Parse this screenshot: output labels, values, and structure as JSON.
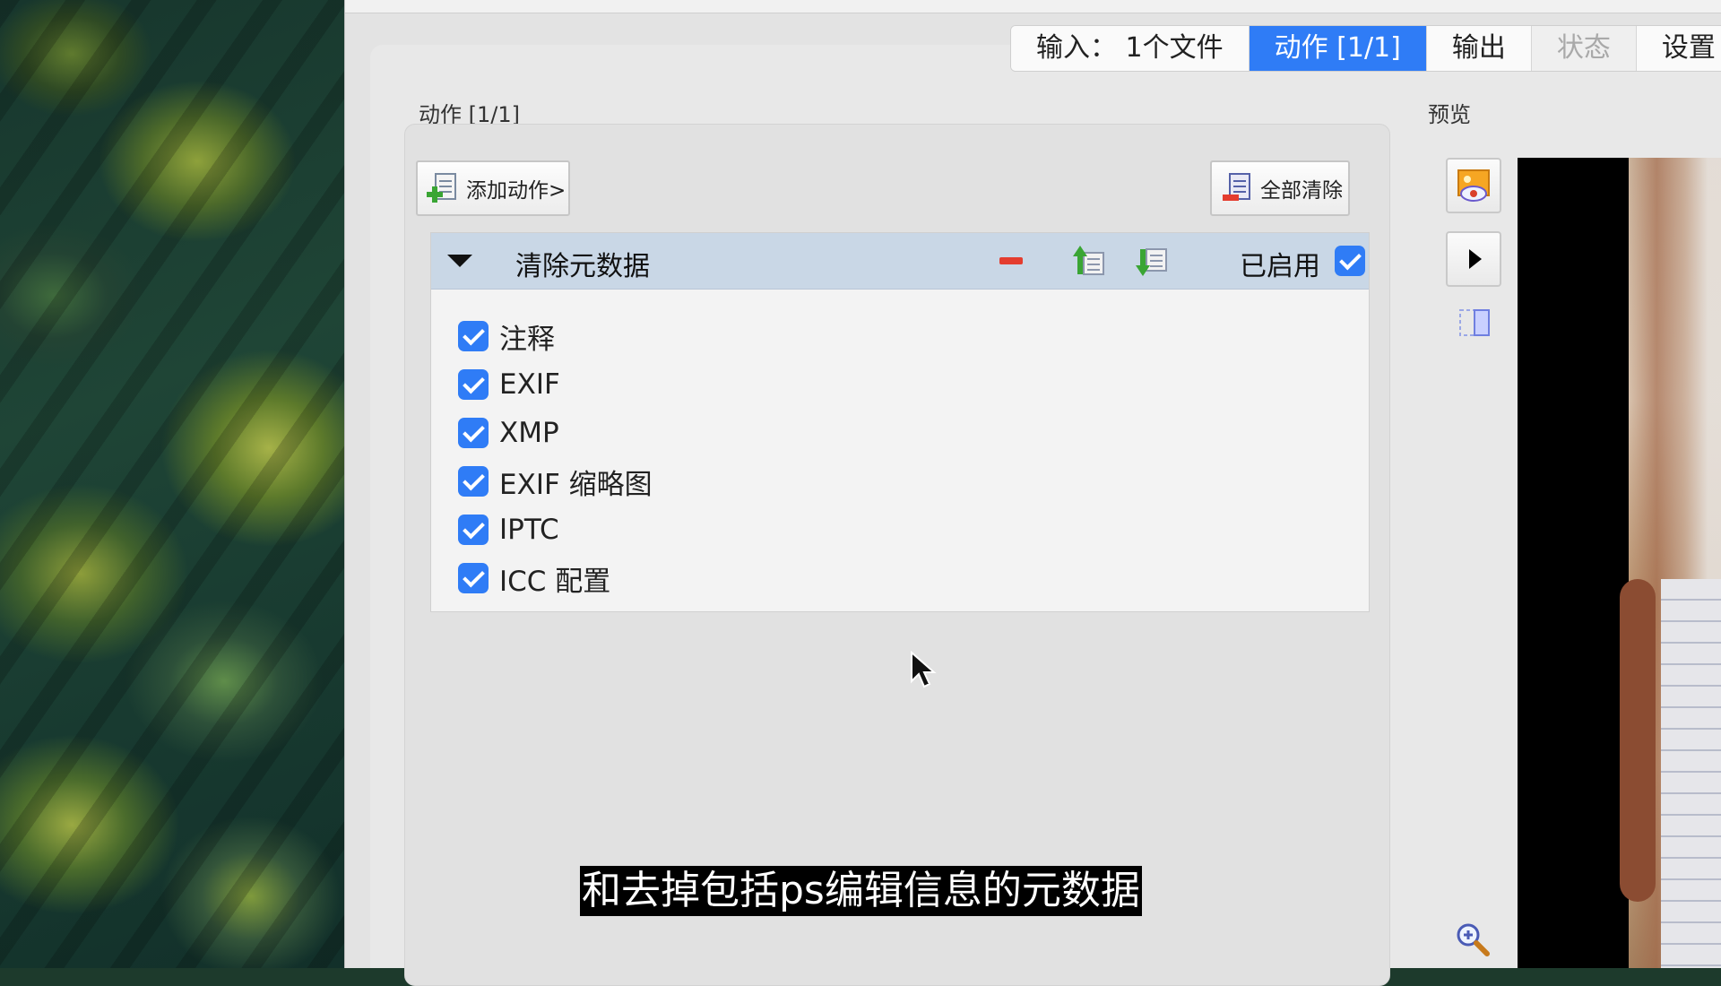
{
  "tabs": [
    {
      "label": "输入： 1个文件",
      "state": "normal"
    },
    {
      "label": "动作 [1/1]",
      "state": "active"
    },
    {
      "label": "输出",
      "state": "normal"
    },
    {
      "label": "状态",
      "state": "disabled"
    },
    {
      "label": "设置",
      "state": "normal"
    }
  ],
  "actions_panel": {
    "title": "动作 [1/1]",
    "add_action_label": "添加动作>",
    "clear_all_label": "全部清除",
    "action": {
      "name": "清除元数据",
      "enabled_label": "已启用",
      "enabled": true,
      "options": [
        {
          "label": "注释",
          "checked": true
        },
        {
          "label": "EXIF",
          "checked": true
        },
        {
          "label": "XMP",
          "checked": true
        },
        {
          "label": "EXIF 缩略图",
          "checked": true
        },
        {
          "label": "IPTC",
          "checked": true
        },
        {
          "label": "ICC 配置",
          "checked": true
        }
      ]
    }
  },
  "preview": {
    "title": "预览"
  },
  "subtitle": "和去掉包括ps编辑信息的元数据",
  "colors": {
    "accent": "#2f7cf6",
    "header": "#c9d7e6",
    "remove": "#e43d2f"
  }
}
